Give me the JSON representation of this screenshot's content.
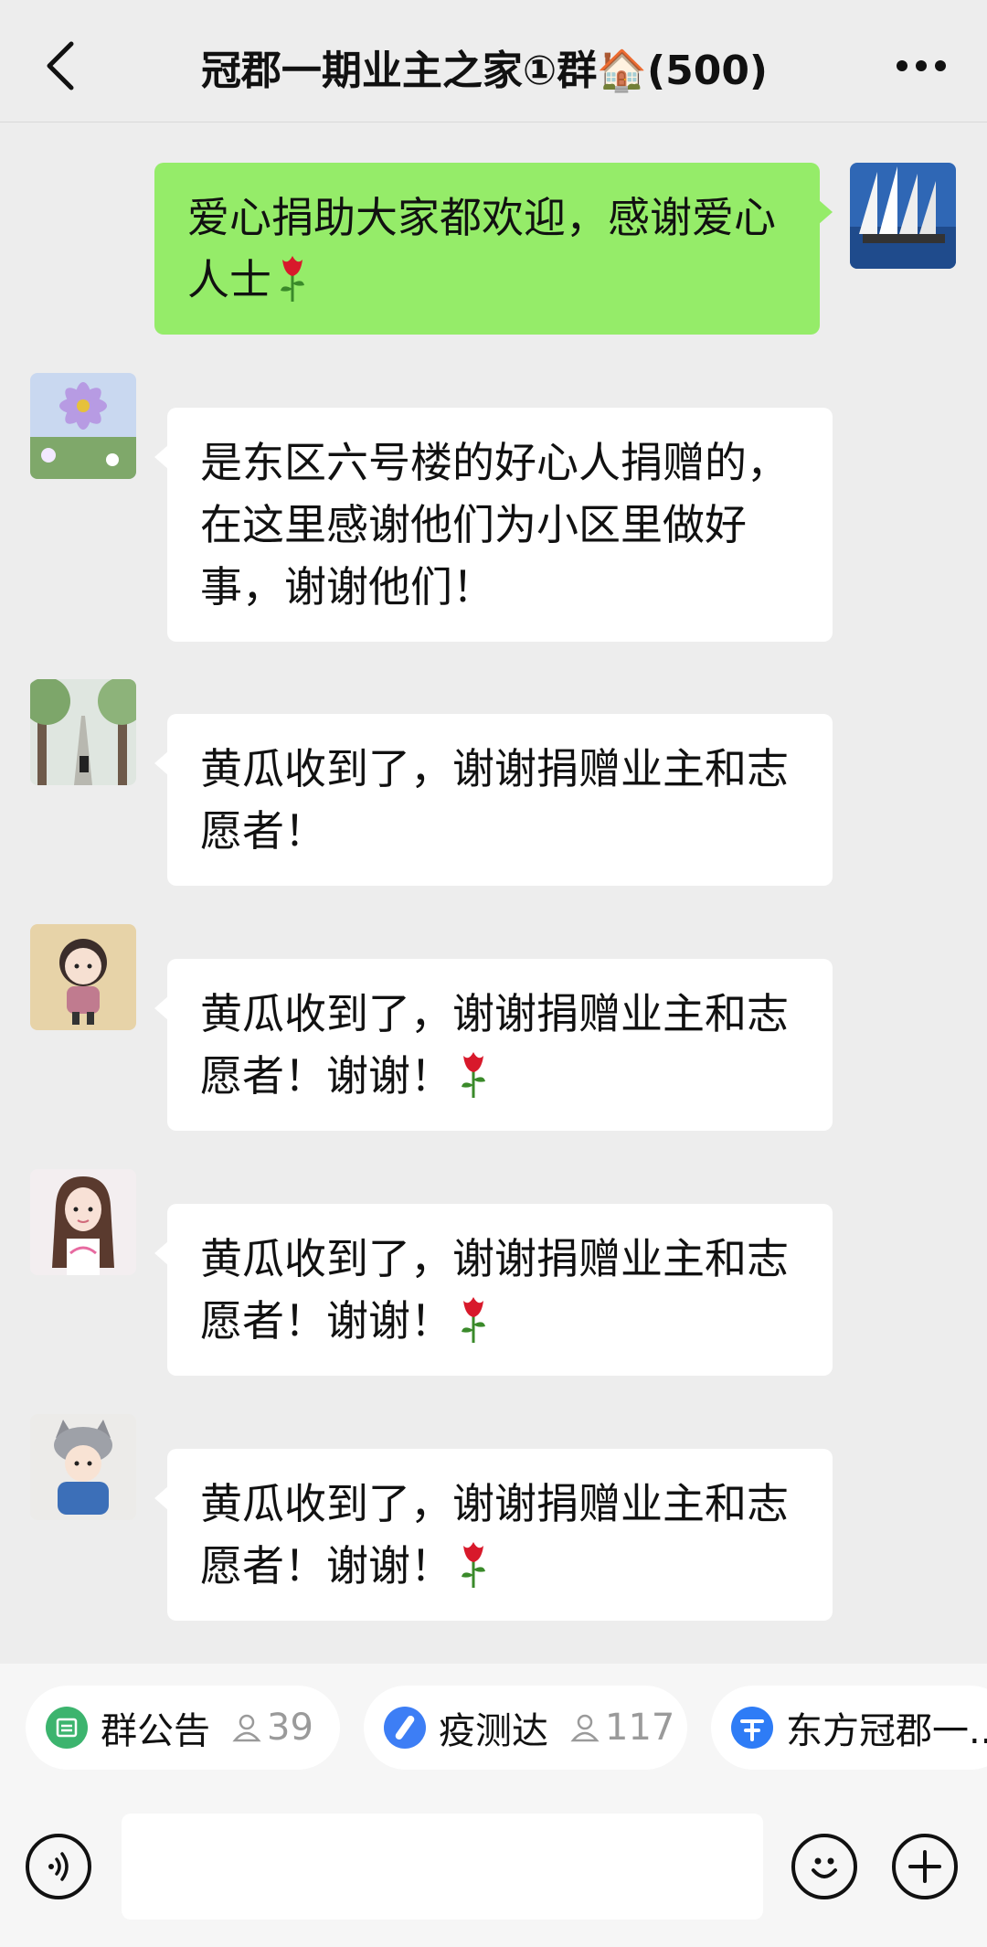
{
  "header": {
    "back_icon": "chevron-left-icon",
    "title": "冠郡一期业主之家①群🏠(500)",
    "more_icon": "more-dots-icon"
  },
  "messages": [
    {
      "direction": "out",
      "avatar": "sailing-ship-avatar",
      "text": "爱心捐助大家都欢迎，感谢爱心人士",
      "emoji": "rose"
    },
    {
      "direction": "in",
      "avatar": "cosmos-flower-avatar",
      "text": "是东区六号楼的好心人捐赠的，在这里感谢他们为小区里做好事，谢谢他们！",
      "emoji": ""
    },
    {
      "direction": "in",
      "avatar": "tree-road-avatar",
      "text": "黄瓜收到了，谢谢捐赠业主和志愿者！",
      "emoji": ""
    },
    {
      "direction": "in",
      "avatar": "cartoon-girl-avatar",
      "text": "黄瓜收到了，谢谢捐赠业主和志愿者！谢谢！",
      "emoji": "rose"
    },
    {
      "direction": "in",
      "avatar": "long-hair-girl-avatar",
      "text": "黄瓜收到了，谢谢捐赠业主和志愿者！谢谢！",
      "emoji": "rose"
    },
    {
      "direction": "in",
      "avatar": "cat-hat-kid-avatar",
      "text": "黄瓜收到了，谢谢捐赠业主和志愿者！谢谢！",
      "emoji": "rose"
    }
  ],
  "quick_links": [
    {
      "label": "群公告",
      "count": "39",
      "icon": "announcement-icon",
      "color": "#3cb46e"
    },
    {
      "label": "疫测达",
      "count": "117",
      "icon": "test-tube-icon",
      "color": "#3d7ef5"
    },
    {
      "label": "东方冠郡一...",
      "count": "",
      "icon": "blue-logo-icon",
      "color": "#2e7cf6"
    }
  ],
  "input_bar": {
    "voice_icon": "voice-icon",
    "input_value": "",
    "emoji_icon": "smiley-icon",
    "plus_icon": "plus-icon"
  },
  "colors": {
    "background": "#ededed",
    "outgoing_bubble": "#95ec69",
    "incoming_bubble": "#ffffff"
  }
}
